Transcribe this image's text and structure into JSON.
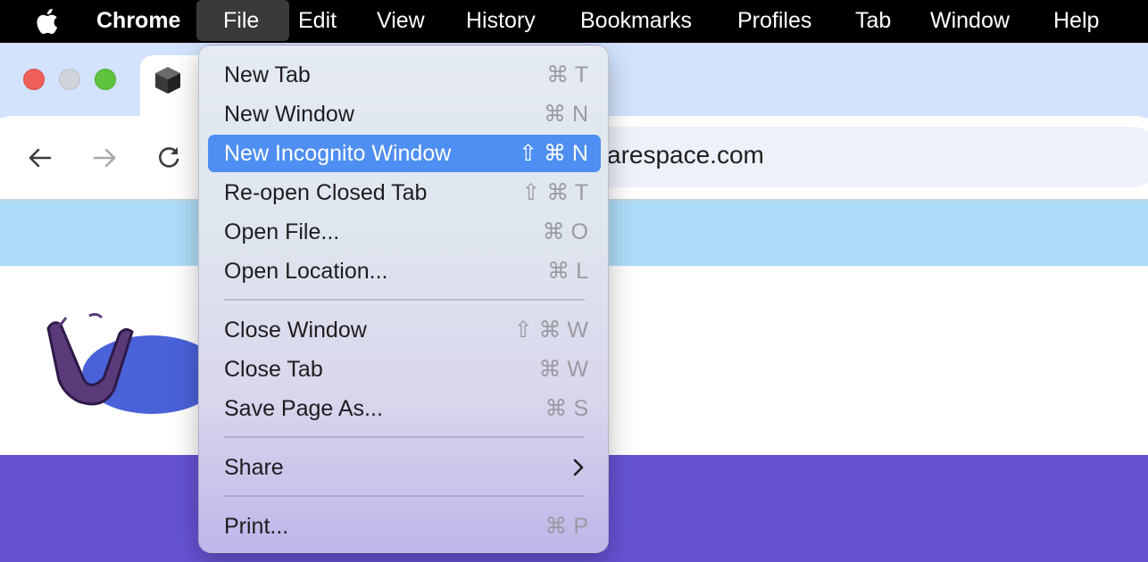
{
  "menubar": {
    "app_name": "Chrome",
    "items": [
      "File",
      "Edit",
      "View",
      "History",
      "Bookmarks",
      "Profiles",
      "Tab",
      "Window",
      "Help"
    ],
    "active_item": "File"
  },
  "browser": {
    "address_text": "arespace.com"
  },
  "file_menu": {
    "items": [
      {
        "label": "New Tab",
        "shortcut": "⌘ T"
      },
      {
        "label": "New Window",
        "shortcut": "⌘ N"
      },
      {
        "label": "New Incognito Window",
        "shortcut": "⇧ ⌘ N",
        "highlighted": true
      },
      {
        "label": "Re-open Closed Tab",
        "shortcut": "⇧ ⌘ T"
      },
      {
        "label": "Open File...",
        "shortcut": "⌘ O"
      },
      {
        "label": "Open Location...",
        "shortcut": "⌘ L"
      },
      {
        "label": "Close Window",
        "shortcut": "⇧ ⌘ W"
      },
      {
        "label": "Close Tab",
        "shortcut": "⌘ W"
      },
      {
        "label": "Save Page As...",
        "shortcut": "⌘ S"
      },
      {
        "label": "Share",
        "submenu": true
      },
      {
        "label": "Print...",
        "shortcut": "⌘ P"
      }
    ]
  },
  "colors": {
    "menu_highlight": "#4f8ef2",
    "tabstrip": "#d3e3fd",
    "banner": "#aedcf8",
    "footer": "#6553d3"
  }
}
